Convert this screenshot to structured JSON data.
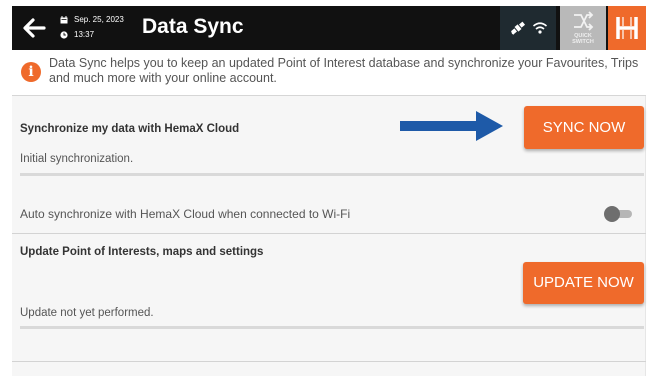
{
  "header": {
    "date": "Sep. 25, 2023",
    "time": "13:37",
    "title": "Data Sync",
    "quick_switch_line1": "QUICK",
    "quick_switch_line2": "SWITCH",
    "logo_text": "H"
  },
  "info": {
    "icon": "i",
    "text": "Data Sync helps you to keep an updated Point of Interest database and synchronize your Favourites, Trips and much more with your online account."
  },
  "sync": {
    "label": "Synchronize my data with HemaX Cloud",
    "button": "SYNC NOW",
    "status": "Initial synchronization."
  },
  "auto_sync": {
    "label": "Auto synchronize with HemaX Cloud when connected to Wi-Fi",
    "enabled": false
  },
  "update": {
    "label": "Update Point of Interests, maps and settings",
    "button": "UPDATE NOW",
    "status": "Update not yet performed."
  },
  "colors": {
    "accent": "#ef6a2b",
    "header_bg": "#111111",
    "arrow": "#1e5aa8"
  }
}
